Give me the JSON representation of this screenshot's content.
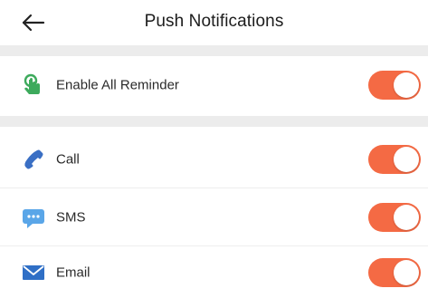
{
  "header": {
    "title": "Push Notifications",
    "back_icon": "arrow-left-icon"
  },
  "settings": [
    {
      "label": "Enable All Reminder",
      "icon": "touch-hand-icon",
      "enabled": true
    },
    {
      "label": "Call",
      "icon": "phone-icon",
      "enabled": true
    },
    {
      "label": "SMS",
      "icon": "message-bubble-icon",
      "enabled": true
    },
    {
      "label": "Email",
      "icon": "envelope-icon",
      "enabled": true
    }
  ],
  "colors": {
    "toggle_on": "#f46a44",
    "section_band": "#ececec"
  }
}
